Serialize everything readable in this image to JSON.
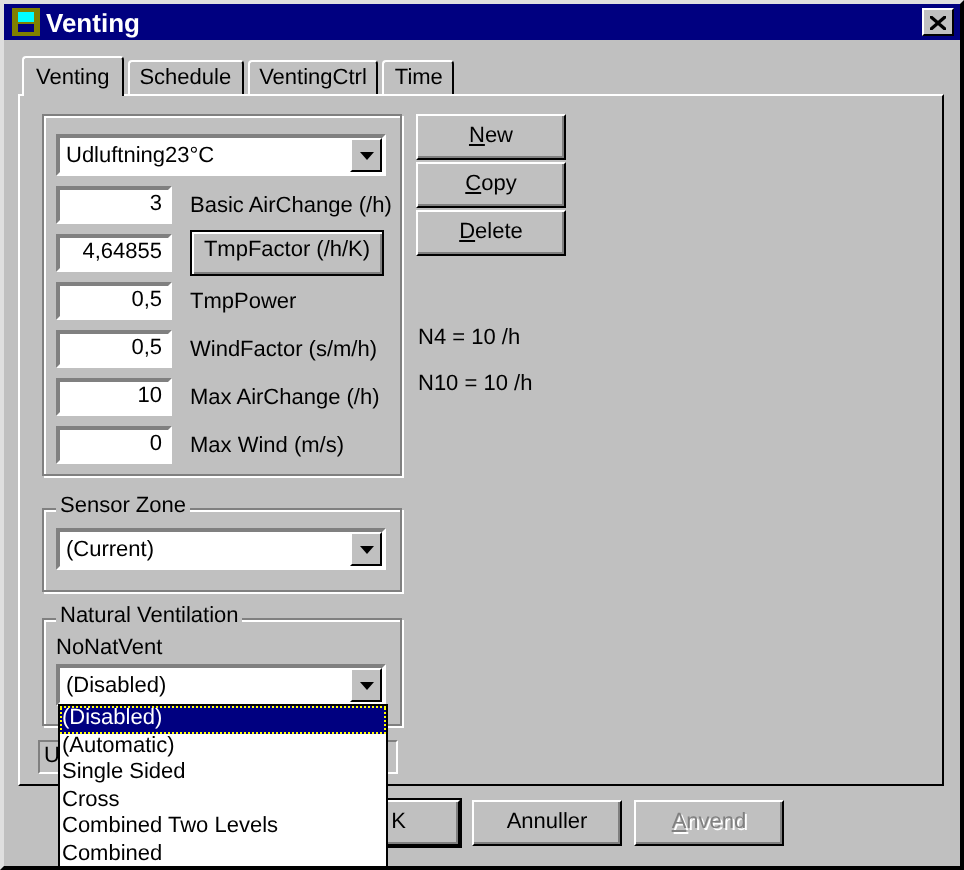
{
  "window": {
    "title": "Venting"
  },
  "tabs": [
    {
      "label": "Venting",
      "selected": true
    },
    {
      "label": "Schedule",
      "selected": false
    },
    {
      "label": "VentingCtrl",
      "selected": false
    },
    {
      "label": "Time",
      "selected": false
    }
  ],
  "profile": {
    "value": "Udluftning23°C"
  },
  "parameters": [
    {
      "value": "3",
      "label": "Basic AirChange (/h)",
      "kind": "text"
    },
    {
      "value": "4,64855",
      "label": "TmpFactor (/h/K)",
      "kind": "button"
    },
    {
      "value": "0,5",
      "label": "TmpPower",
      "kind": "text"
    },
    {
      "value": "0,5",
      "label": "WindFactor (s/m/h)",
      "kind": "text"
    },
    {
      "value": "10",
      "label": "Max AirChange (/h)",
      "kind": "text"
    },
    {
      "value": "0",
      "label": "Max Wind  (m/s)",
      "kind": "text"
    }
  ],
  "actions": [
    {
      "label": "New",
      "disabled": false
    },
    {
      "label": "Copy",
      "disabled": false
    },
    {
      "label": "Delete",
      "disabled": false
    }
  ],
  "readings": [
    "N4 = 10 /h",
    "N10 = 10 /h"
  ],
  "sensor_zone": {
    "label": "Sensor Zone",
    "value": "(Current)"
  },
  "natural_ventilation": {
    "label": "Natural Ventilation",
    "name": "NoNatVent",
    "value": "(Disabled)",
    "open": true,
    "options": [
      {
        "label": "(Disabled)",
        "selected": true
      },
      {
        "label": "(Automatic)",
        "selected": false
      },
      {
        "label": "Single Sided",
        "selected": false
      },
      {
        "label": "Cross",
        "selected": false
      },
      {
        "label": "Combined Two Levels",
        "selected": false
      },
      {
        "label": "Combined",
        "selected": false
      }
    ]
  },
  "hidden_field": {
    "value": "U"
  },
  "buttons": [
    {
      "label": "K",
      "disabled": false
    },
    {
      "label": "Annuller",
      "disabled": false
    },
    {
      "label": "Anvend",
      "disabled": true
    }
  ]
}
